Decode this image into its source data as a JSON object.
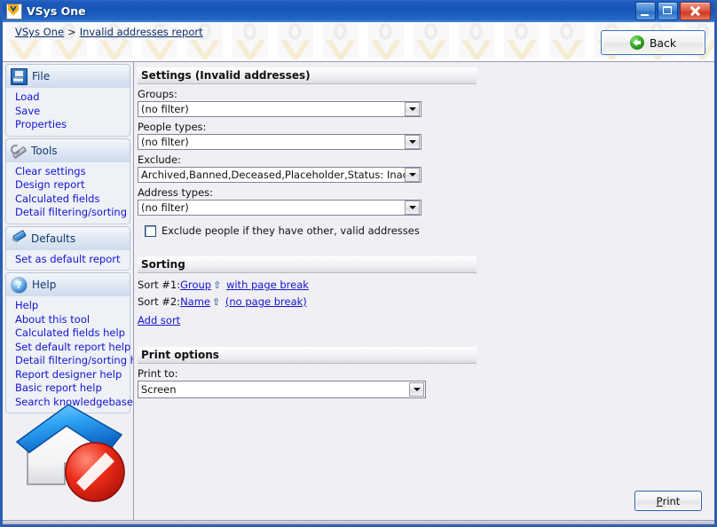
{
  "window": {
    "title": "VSys One",
    "app_icon": "vsys-shield-icon",
    "minimize_label": "Minimize",
    "maximize_label": "Maximize",
    "close_label": "Close"
  },
  "breadcrumb": {
    "root": "VSys One",
    "separator": ">",
    "current": "Invalid addresses report"
  },
  "back_button": {
    "label": "Back",
    "icon": "back-arrow-icon"
  },
  "sidebar": {
    "groups": [
      {
        "title": "File",
        "icon": "floppy-disk-icon",
        "links": [
          "Load",
          "Save",
          "Properties"
        ]
      },
      {
        "title": "Tools",
        "icon": "wrench-icon",
        "links": [
          "Clear settings",
          "Design report",
          "Calculated fields",
          "Detail filtering/sorting"
        ]
      },
      {
        "title": "Defaults",
        "icon": "pushpin-icon",
        "links": [
          "Set as default report"
        ]
      },
      {
        "title": "Help",
        "icon": "question-mark-icon",
        "links": [
          "Help",
          "About this tool",
          "Calculated fields help",
          "Set default report help",
          "Detail filtering/sorting help",
          "Report designer help",
          "Basic report help",
          "Search knowledgebase"
        ]
      }
    ],
    "logo": {
      "name": "invalid-address-house-icon",
      "roof_color": "#2b9cf0",
      "deny_color": "#e02020"
    }
  },
  "main": {
    "settings": {
      "heading": "Settings (Invalid addresses)",
      "fields": [
        {
          "label": "Groups:",
          "value": "(no filter)",
          "name": "groups"
        },
        {
          "label": "People types:",
          "value": "(no filter)",
          "name": "people-types"
        },
        {
          "label": "Exclude:",
          "value": "Archived,Banned,Deceased,Placeholder,Status: Inactive,Sta",
          "name": "exclude"
        },
        {
          "label": "Address types:",
          "value": "(no filter)",
          "name": "address-types"
        }
      ],
      "checkbox": {
        "label": "Exclude people if they have other, valid addresses",
        "checked": false
      }
    },
    "sorting": {
      "heading": "Sorting",
      "rows": [
        {
          "prefix": "Sort #1:",
          "field": "Group",
          "direction": "⇧",
          "pagebreak": "with page break"
        },
        {
          "prefix": "Sort #2:",
          "field": "Name",
          "direction": "⇧",
          "pagebreak": "(no page break)"
        }
      ],
      "add_label": "Add sort"
    },
    "print_options": {
      "heading": "Print options",
      "label": "Print to:",
      "value": "Screen"
    },
    "print_button": {
      "prefix": "",
      "accelerator": "P",
      "suffix": "rint"
    }
  },
  "colors": {
    "titlebar": "#1656b8",
    "link": "#1414d2",
    "breadcrumb_link": "#0b2a66",
    "panel_bg": "#f0f0f4"
  }
}
